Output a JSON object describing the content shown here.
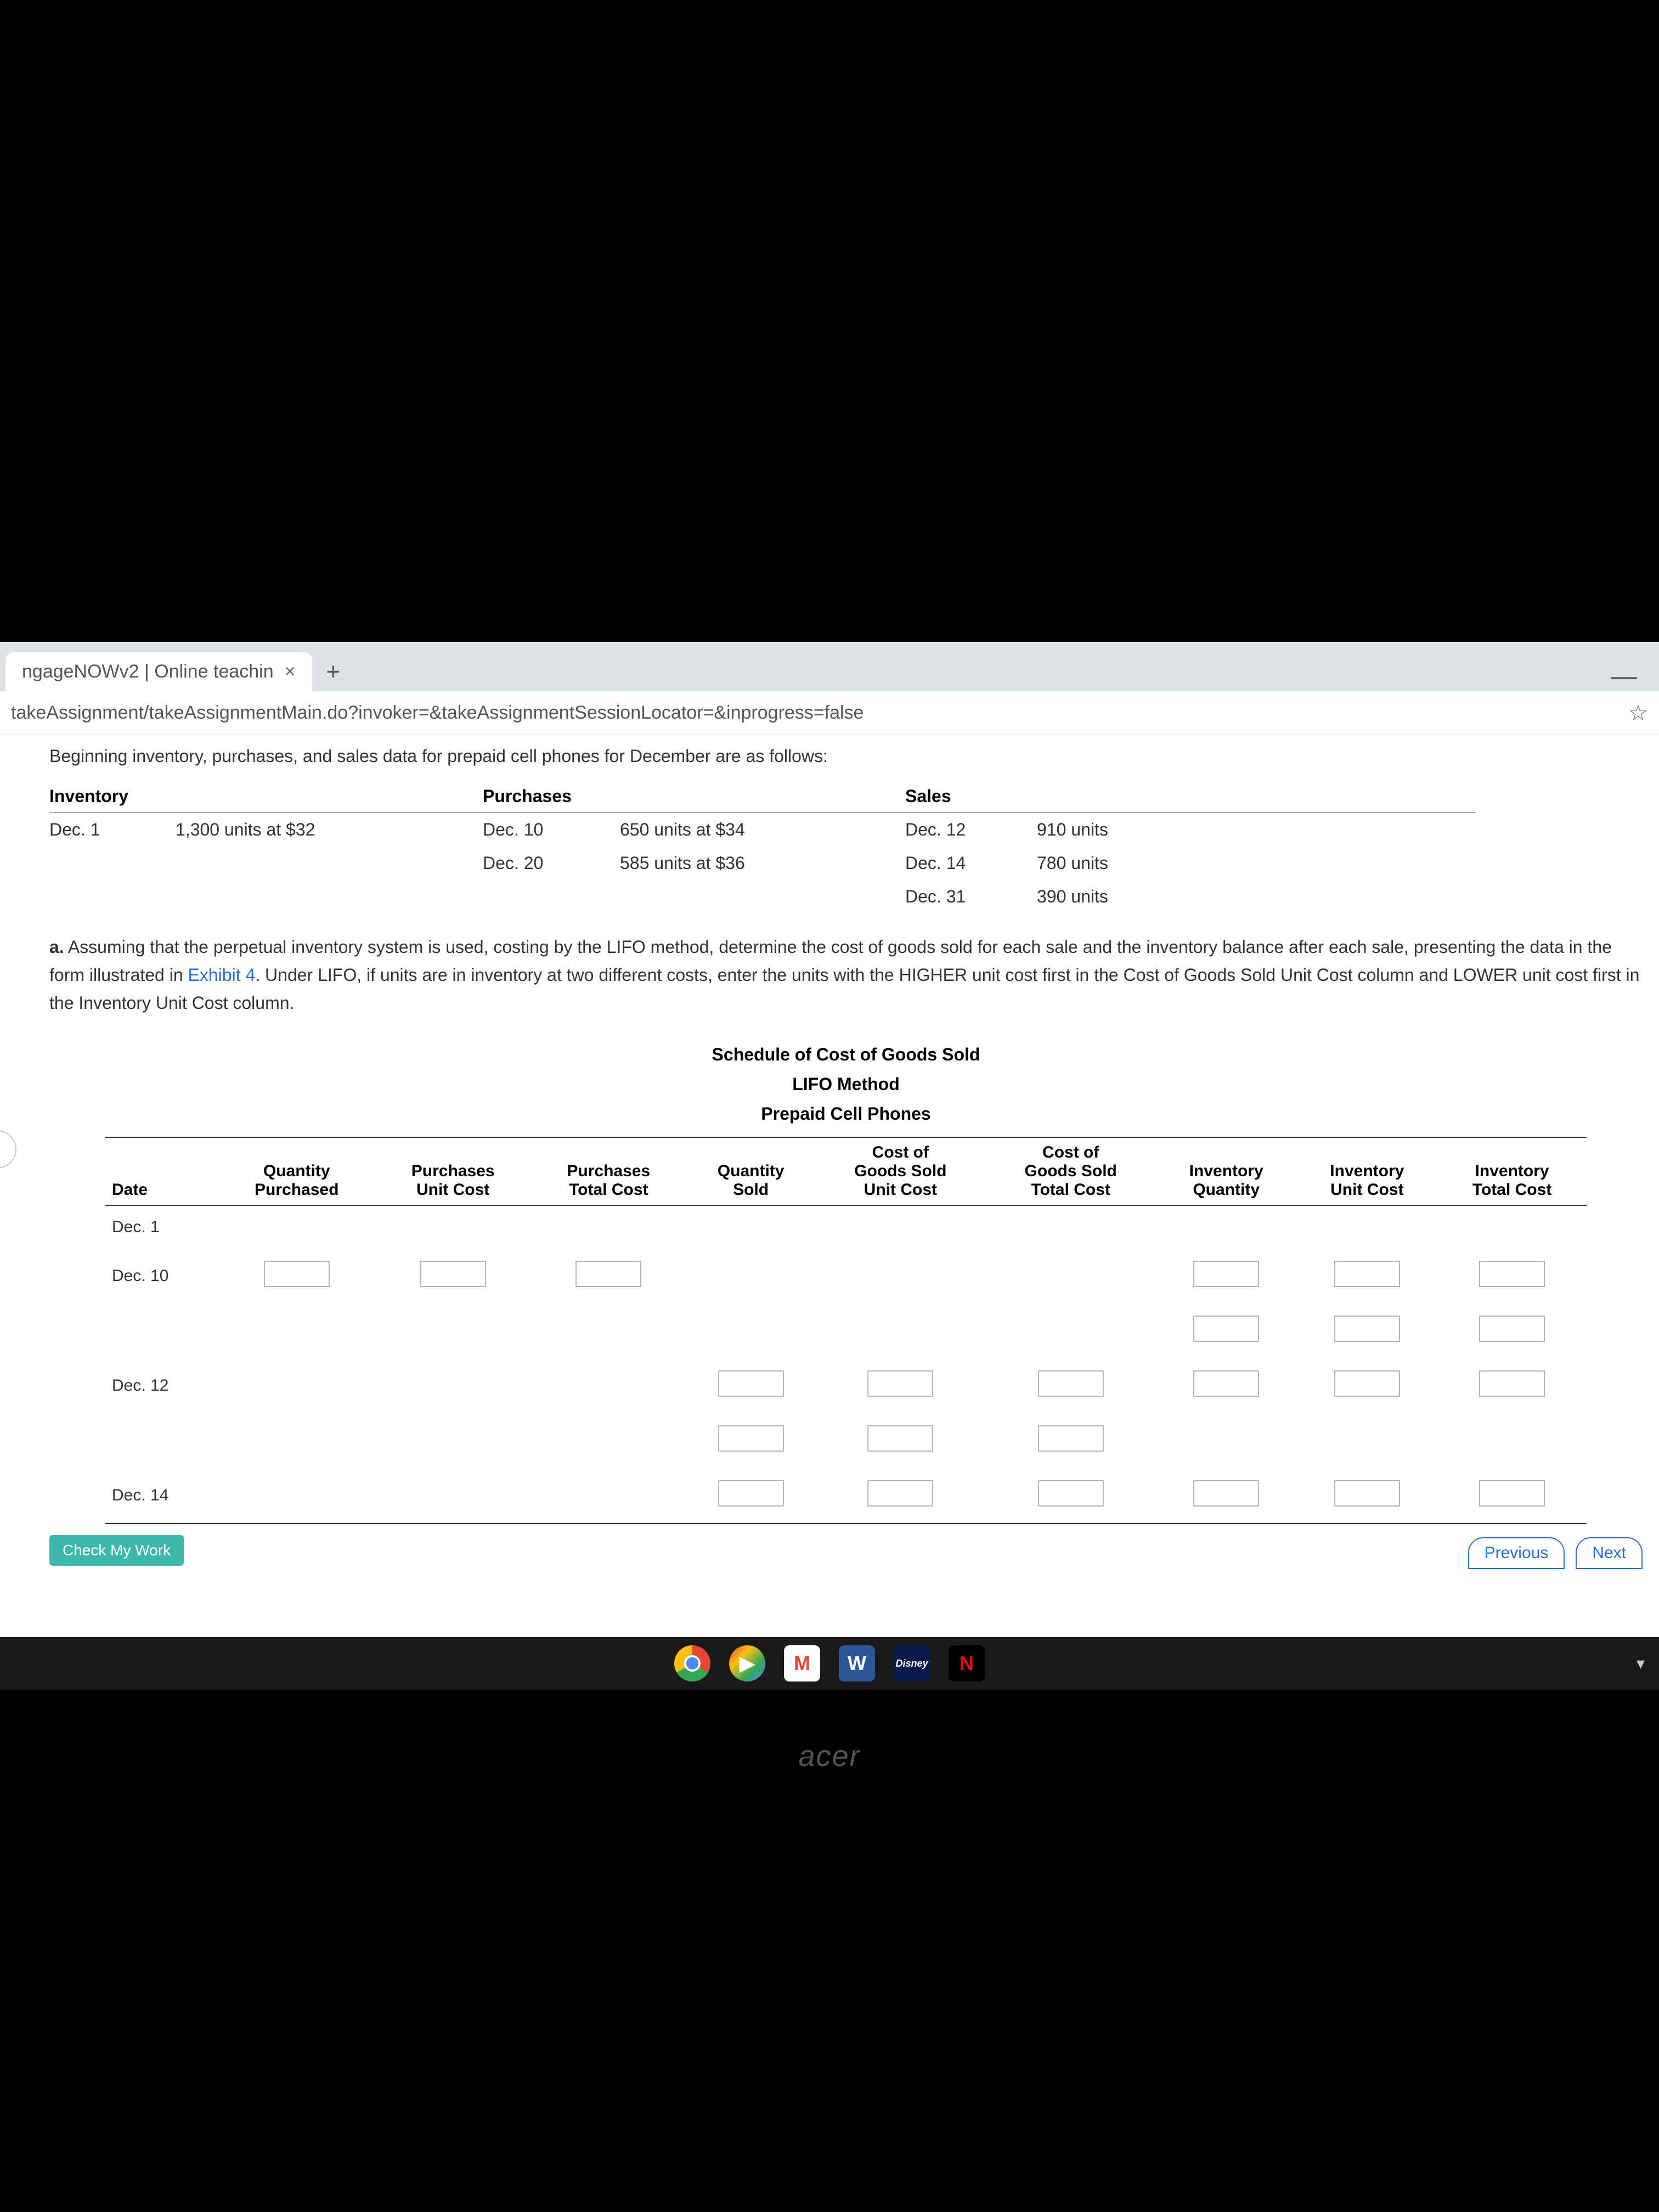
{
  "browser": {
    "tab_title": "ngageNOWv2 | Online teachin",
    "url": "takeAssignment/takeAssignmentMain.do?invoker=&takeAssignmentSessionLocator=&inprogress=false",
    "new_tab": "+",
    "minimize": "—",
    "close_tab": "×",
    "star": "☆"
  },
  "intro": "Beginning inventory, purchases, and sales data for prepaid cell phones for December are as follows:",
  "headers": {
    "inventory": "Inventory",
    "purchases": "Purchases",
    "sales": "Sales"
  },
  "inventory_row": {
    "date": "Dec. 1",
    "desc": "1,300 units at $32"
  },
  "purchases_rows": [
    {
      "date": "Dec. 10",
      "desc": "650 units at $34"
    },
    {
      "date": "Dec. 20",
      "desc": "585 units at $36"
    }
  ],
  "sales_rows": [
    {
      "date": "Dec. 12",
      "units": "910 units"
    },
    {
      "date": "Dec. 14",
      "units": "780 units"
    },
    {
      "date": "Dec. 31",
      "units": "390 units"
    }
  ],
  "question": {
    "label": "a.",
    "text1": " Assuming that the perpetual inventory system is used, costing by the LIFO method, determine the cost of goods sold for each sale and the inventory balance after each sale, presenting the data in the form illustrated in ",
    "link": "Exhibit 4",
    "text2": ". Under LIFO, if units are in inventory at two different costs, enter the units with the HIGHER unit cost first in the Cost of Goods Sold Unit Cost column and LOWER unit cost first in the Inventory Unit Cost column."
  },
  "schedule": {
    "title1": "Schedule of Cost of Goods Sold",
    "title2": "LIFO Method",
    "title3": "Prepaid Cell Phones",
    "cols": {
      "date": "Date",
      "qty_purch": "Quantity\nPurchased",
      "purch_uc": "Purchases\nUnit Cost",
      "purch_tc": "Purchases\nTotal Cost",
      "qty_sold": "Quantity\nSold",
      "cogs_uc": "Cost of\nGoods Sold\nUnit Cost",
      "cogs_tc": "Cost of\nGoods Sold\nTotal Cost",
      "inv_qty": "Inventory\nQuantity",
      "inv_uc": "Inventory\nUnit Cost",
      "inv_tc": "Inventory\nTotal Cost"
    },
    "row_dates": [
      "Dec. 1",
      "Dec. 10",
      "",
      "Dec. 12",
      "",
      "Dec. 14"
    ]
  },
  "buttons": {
    "check": "Check My Work",
    "previous": "Previous",
    "next": "Next"
  },
  "taskbar": {
    "gmail": "M",
    "word": "W",
    "disney": "Disney",
    "netflix": "N",
    "play": "▶",
    "wifi": "▾"
  },
  "brand": "acer"
}
